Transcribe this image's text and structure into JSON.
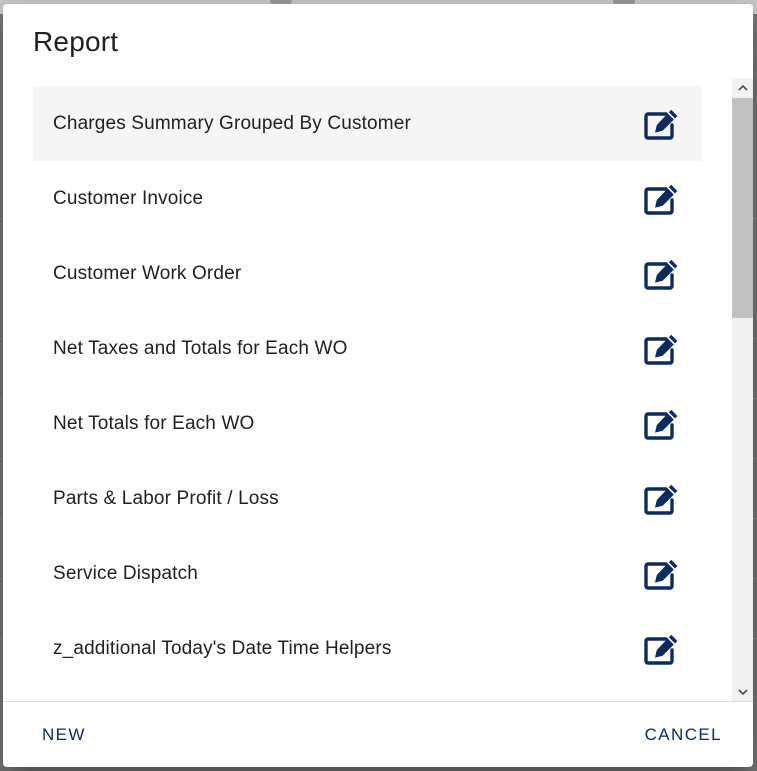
{
  "dialog": {
    "title": "Report"
  },
  "reports": [
    {
      "label": "Charges Summary Grouped By Customer",
      "icon": "edit-icon"
    },
    {
      "label": "Customer Invoice",
      "icon": "edit-icon"
    },
    {
      "label": "Customer Work Order",
      "icon": "edit-icon"
    },
    {
      "label": "Net Taxes and Totals for Each WO",
      "icon": "edit-icon"
    },
    {
      "label": "Net Totals for Each WO",
      "icon": "edit-icon"
    },
    {
      "label": "Parts & Labor Profit / Loss",
      "icon": "edit-icon"
    },
    {
      "label": "Service Dispatch",
      "icon": "edit-icon"
    },
    {
      "label": "z_additional Today's Date Time Helpers",
      "icon": "edit-icon"
    }
  ],
  "actions": {
    "new_label": "NEW",
    "cancel_label": "CANCEL"
  },
  "colors": {
    "accent": "#0d2b5c",
    "icon": "#0d2b5c",
    "selected_row": "#f5f5f5"
  }
}
